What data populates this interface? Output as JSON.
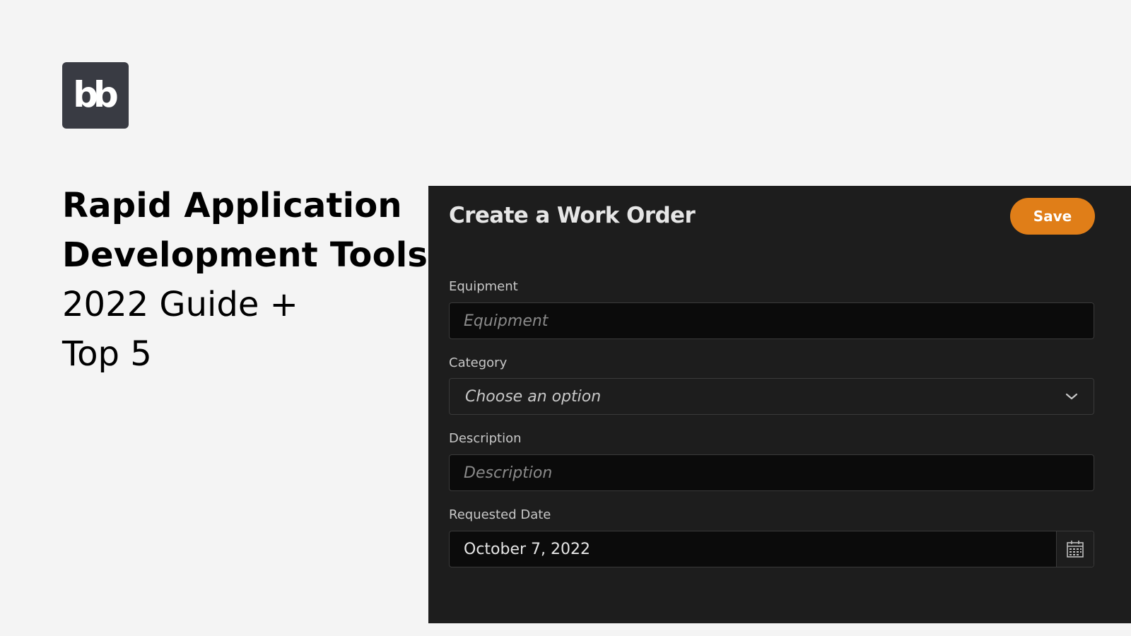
{
  "brand": {
    "logo_text": "bb"
  },
  "headline": {
    "line1": "Rapid Application",
    "line2": "Development Tools",
    "line3": "2022 Guide +",
    "line4": "Top 5"
  },
  "form": {
    "title": "Create a Work Order",
    "save_label": "Save",
    "fields": {
      "equipment": {
        "label": "Equipment",
        "placeholder": "Equipment"
      },
      "category": {
        "label": "Category",
        "selected": "Choose an option"
      },
      "description": {
        "label": "Description",
        "placeholder": "Description"
      },
      "requested_date": {
        "label": "Requested Date",
        "value": "October 7, 2022"
      }
    }
  },
  "icons": {
    "category_dropdown": "chevron-down-icon",
    "date_picker": "calendar-icon"
  },
  "colors": {
    "page_background": "#f4f4f4",
    "logo_background": "#393b43",
    "panel_background": "#1d1d1d",
    "input_background": "#0b0b0b",
    "accent": "#e07e18"
  }
}
